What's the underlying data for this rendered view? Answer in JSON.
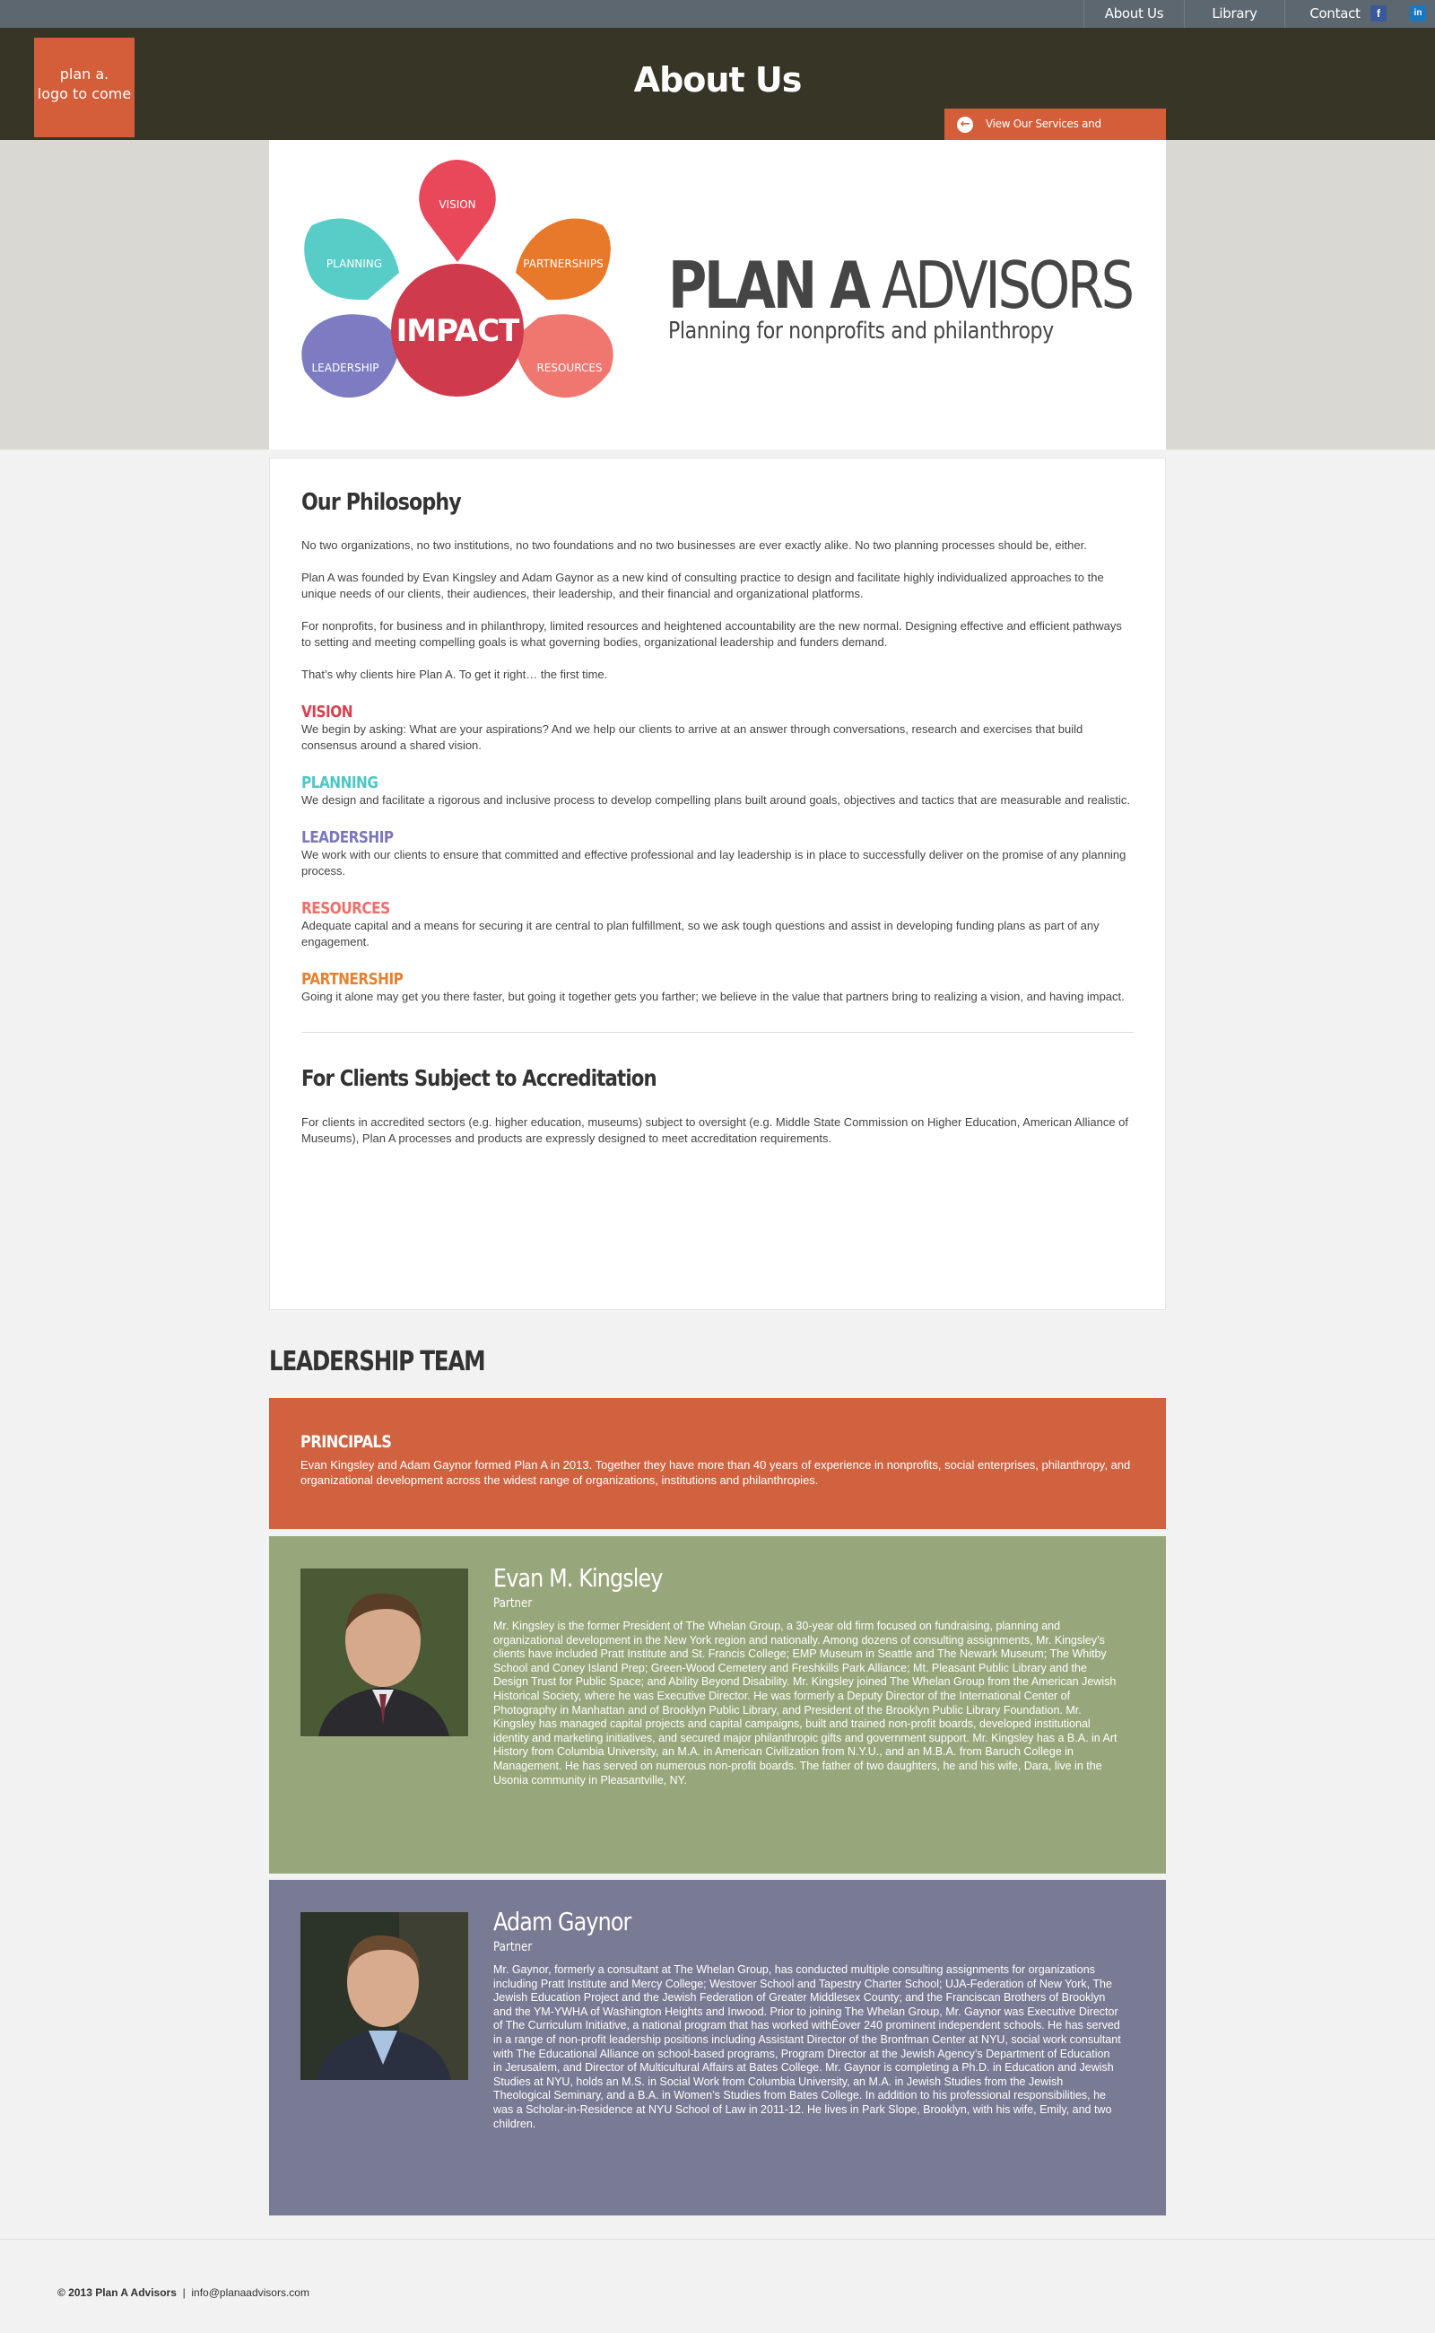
{
  "nav": {
    "links": [
      "About Us",
      "Library",
      "Contact"
    ],
    "facebook_icon": "f",
    "linkedin_icon": "in"
  },
  "header": {
    "logo_line1": "plan a.",
    "logo_line2": "logo to come",
    "title": "About Us",
    "services_button": "View Our Services and Organizations"
  },
  "hero": {
    "diagram": {
      "center": "IMPACT",
      "petals": [
        "VISION",
        "PARTNERSHIPS",
        "RESOURCES",
        "LEADERSHIP",
        "PLANNING"
      ]
    },
    "brand_bold": "PLAN A",
    "brand_light": "ADVISORS",
    "tagline": "Planning for nonprofits and philanthropy"
  },
  "philosophy": {
    "title": "Our Philosophy",
    "paragraphs": [
      "No two organizations, no two institutions, no two foundations and no two businesses are ever exactly alike.  No two planning processes should be, either.",
      "Plan A was founded by Evan Kingsley and Adam Gaynor as a new kind of consulting practice to design and facilitate highly individualized approaches to the unique needs of our clients, their audiences, their leadership, and their financial and organizational platforms.",
      "For nonprofits, for business and in philanthropy, limited resources and heightened accountability are the new normal.  Designing effective and efficient pathways to setting and meeting compelling goals is what governing bodies, organizational leadership and funders demand.",
      "That’s why clients hire Plan A. To get it right… the first time."
    ],
    "pillars": [
      {
        "title": "VISION",
        "color": "#d9414f",
        "text": "We begin by asking: What are your aspirations? And we help our clients to arrive at an answer through conversations, research and exercises that build consensus around a shared vision."
      },
      {
        "title": "PLANNING",
        "color": "#4ec7c4",
        "text": "We design and facilitate a rigorous and inclusive process to develop compelling plans built around goals, objectives and tactics that are measurable and realistic."
      },
      {
        "title": "LEADERSHIP",
        "color": "#7a78bb",
        "text": "We work with our clients to ensure that committed and effective professional and lay leadership is in place to successfully deliver on the promise of any planning process."
      },
      {
        "title": "RESOURCES",
        "color": "#ee6f6a",
        "text": "Adequate capital and a means for securing it are central to plan fulfillment, so we ask tough questions and assist in developing funding plans as part of any engagement."
      },
      {
        "title": "PARTNERSHIP",
        "color": "#e58230",
        "text": "Going it alone may get you there faster, but going it together gets you farther; we believe in the value that partners bring to realizing a vision, and having impact."
      }
    ]
  },
  "accreditation": {
    "title": "For Clients Subject to Accreditation",
    "text": "For clients in accredited sectors (e.g. higher education, museums) subject to oversight (e.g. Middle State Commission on Higher Education, American Alliance of Museums), Plan A processes and products are expressly designed to meet accreditation requirements."
  },
  "team": {
    "title": "LEADERSHIP TEAM",
    "principals_title": "PRINCIPALS",
    "principals_text": "Evan Kingsley and Adam Gaynor formed Plan A in 2013.  Together they have more than 40 years of experience in nonprofits, social enterprises, philanthropy, and organizational development across the widest range of organizations, institutions and philanthropies.",
    "members": [
      {
        "name": "Evan M. Kingsley",
        "role": "Partner",
        "bio": "Mr. Kingsley is the former President of The Whelan Group, a 30-year old firm focused on fundraising, planning and organizational development in the New York region and nationally.  Among dozens of consulting assignments, Mr. Kingsley’s clients have included Pratt Institute and St. Francis College; EMP Museum in Seattle and The Newark Museum; The Whitby School and Coney Island Prep; Green-Wood Cemetery and Freshkills Park Alliance; Mt. Pleasant Public Library and the Design Trust for Public Space; and Ability Beyond Disability.  Mr. Kingsley joined The Whelan Group from the American Jewish Historical Society, where he was Executive Director. He was formerly a Deputy Director of the International Center of Photography in Manhattan and of Brooklyn Public Library, and President of the Brooklyn Public Library Foundation.  Mr. Kingsley has managed capital projects and capital campaigns, built and trained non-profit boards, developed institutional identity and marketing initiatives, and secured major philanthropic gifts and government support.  Mr. Kingsley has a B.A. in Art History from Columbia University, an M.A. in American Civilization from N.Y.U., and an M.B.A. from Baruch College in Management. He has served on numerous non-profit boards. The father of two daughters, he and his wife, Dara, live in the Usonia community in Pleasantville, NY."
      },
      {
        "name": "Adam Gaynor",
        "role": "Partner",
        "bio": "Mr. Gaynor, formerly a consultant at The Whelan Group, has conducted multiple consulting assignments for organizations including Pratt Institute and Mercy College; Westover School and Tapestry Charter School; UJA-Federation of New York, The Jewish Education Project and the Jewish Federation of Greater Middlesex County; and the Franciscan Brothers of Brooklyn and the YM-YWHA of Washington Heights and Inwood. Prior to joining The Whelan Group, Mr. Gaynor was Executive Director of The Curriculum Initiative, a national program that has worked withÊover 240 prominent independent schools. He has served in a range of non-profit leadership positions including Assistant Director of the Bronfman Center at NYU, social work consultant with The Educational Alliance on school-based programs, Program Director at the Jewish Agency’s Department of Education in Jerusalem, and Director of Multicultural Affairs at Bates College. Mr. Gaynor is completing a Ph.D. in Education and Jewish Studies at NYU, holds an M.S. in Social Work from Columbia University, an M.A. in Jewish Studies from the Jewish Theological Seminary, and a B.A. in Women’s Studies from Bates College. In addition to his professional responsibilities, he was a Scholar-in-Residence at NYU School of Law in 2011-12. He lives in Park Slope, Brooklyn, with his wife, Emily, and two children."
      }
    ]
  },
  "footer": {
    "copyright": "© 2013 Plan A Advisors",
    "separator": "|",
    "email": "info@planaadvisors.com"
  },
  "colors": {
    "accent_orange": "#d35e39",
    "header_dark": "#373526",
    "nav_gray": "#5c6770",
    "kingsley_bg": "#98a77b",
    "gaynor_bg": "#797a93"
  }
}
